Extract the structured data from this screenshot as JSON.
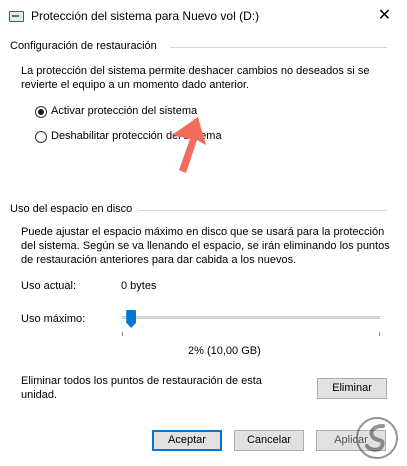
{
  "window": {
    "title": "Protección del sistema para Nuevo vol (D:)",
    "close_glyph": "✕"
  },
  "restore_settings": {
    "heading": "Configuración de restauración",
    "description": "La protección del sistema permite deshacer cambios no deseados si se revierte el equipo a un momento dado anterior.",
    "options": [
      {
        "label": "Activar protección del sistema",
        "selected": true
      },
      {
        "label": "Deshabilitar protección del sistema",
        "selected": false
      }
    ]
  },
  "disk_usage": {
    "heading": "Uso del espacio en disco",
    "description": "Puede ajustar el espacio máximo en disco que se usará para la protección del sistema. Según se va llenando el espacio, se irán eliminando los puntos de restauración anteriores para dar cabida a los nuevos.",
    "current_label": "Uso actual:",
    "current_value": "0 bytes",
    "max_label": "Uso máximo:",
    "max_percent": 2,
    "max_value_text": "2% (10,00 GB)",
    "delete_text": "Eliminar todos los puntos de restauración de esta unidad.",
    "delete_button": "Eliminar"
  },
  "footer": {
    "ok": "Aceptar",
    "cancel": "Cancelar",
    "apply": "Aplicar"
  },
  "colors": {
    "accent": "#0078d7",
    "annotation_arrow": "#f26b5b"
  },
  "icons": {
    "window": "drive-icon",
    "annotation": "arrow-up-icon",
    "watermark": "logo-icon"
  }
}
